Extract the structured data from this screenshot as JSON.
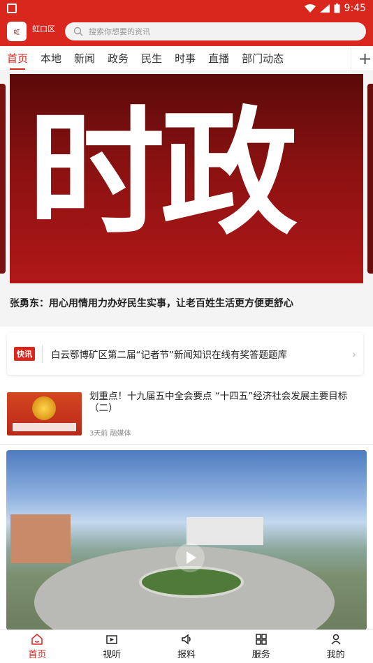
{
  "status": {
    "time": "9:45"
  },
  "header": {
    "region": "虹口区",
    "search_placeholder": "搜索你想要的资讯",
    "logo_text": "虹"
  },
  "tabs": [
    {
      "label": "首页"
    },
    {
      "label": "本地"
    },
    {
      "label": "新闻"
    },
    {
      "label": "政务"
    },
    {
      "label": "民生"
    },
    {
      "label": "时事"
    },
    {
      "label": "直播"
    },
    {
      "label": "部门动态"
    }
  ],
  "banner": {
    "image_text": "时政",
    "title": "张勇东：用心用情用力办好民生实事，让老百姓生活更方便更舒心"
  },
  "quick_news": {
    "badge": "快讯",
    "text": "白云鄂博矿区第二届“记者节”新闻知识在线有奖答题题库"
  },
  "news": {
    "title": "划重点！十九届五中全会要点 “十四五”经济社会发展主要目标（二）",
    "meta": "3天前  融媒体"
  },
  "bottom_nav": [
    {
      "label": "首页",
      "icon": "home-icon"
    },
    {
      "label": "视听",
      "icon": "tv-icon"
    },
    {
      "label": "报料",
      "icon": "megaphone-icon"
    },
    {
      "label": "服务",
      "icon": "grid-icon"
    },
    {
      "label": "我的",
      "icon": "user-icon"
    }
  ],
  "colors": {
    "accent": "#d9271e"
  }
}
